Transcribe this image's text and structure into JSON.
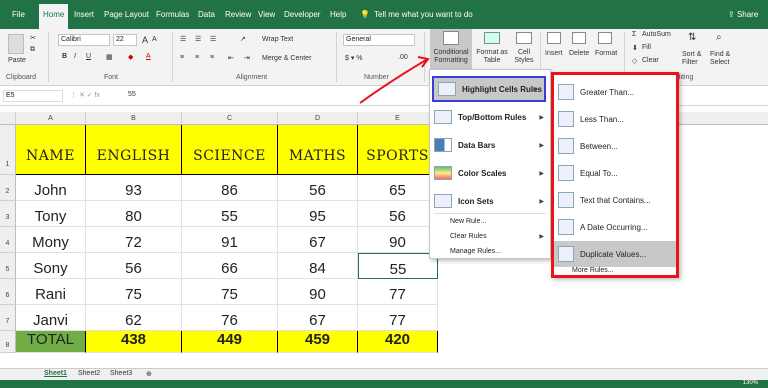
{
  "tabs": [
    "File",
    "Home",
    "Insert",
    "Page Layout",
    "Formulas",
    "Data",
    "Review",
    "View",
    "Developer",
    "Help"
  ],
  "tell_me": "Tell me what you want to do",
  "share": "Share",
  "ribbon": {
    "paste": "Paste",
    "clipboard": "Clipboard",
    "font_name": "Calibri",
    "font_size": "22",
    "font": "Font",
    "wrap_text": "Wrap Text",
    "merge_center": "Merge & Center",
    "alignment": "Alignment",
    "number_format": "General",
    "number": "Number",
    "cond_fmt": "Conditional Formatting",
    "format_table": "Format as Table",
    "cell_styles": "Cell Styles",
    "insert": "Insert",
    "delete": "Delete",
    "format": "Format",
    "autosum": "AutoSum",
    "fill": "Fill",
    "clear": "Clear",
    "editing": "Editing",
    "sort_filter": "Sort & Filter",
    "find_select": "Find & Select",
    "bold": "B",
    "italic": "I",
    "underline": "U",
    "grow": "A",
    "shrink": "A"
  },
  "name_box": "E5",
  "formula_value": "55",
  "columns": [
    "A",
    "B",
    "C",
    "D",
    "E"
  ],
  "headers": [
    "NAME",
    "ENGLISH",
    "SCIENCE",
    "MATHS",
    "SPORTS"
  ],
  "rows": [
    {
      "num": "2",
      "cells": [
        "John",
        "93",
        "86",
        "56",
        "65"
      ]
    },
    {
      "num": "3",
      "cells": [
        "Tony",
        "80",
        "55",
        "95",
        "56"
      ]
    },
    {
      "num": "4",
      "cells": [
        "Mony",
        "72",
        "91",
        "67",
        "90"
      ]
    },
    {
      "num": "5",
      "cells": [
        "Sony",
        "56",
        "66",
        "84",
        "55"
      ]
    },
    {
      "num": "6",
      "cells": [
        "Rani",
        "75",
        "75",
        "90",
        "77"
      ]
    },
    {
      "num": "7",
      "cells": [
        "Janvi",
        "62",
        "76",
        "67",
        "77"
      ]
    }
  ],
  "total": {
    "num": "8",
    "cells": [
      "TOTAL",
      "438",
      "449",
      "459",
      "420"
    ]
  },
  "row_nums": [
    "1"
  ],
  "menu": {
    "items": [
      "Highlight Cells Rules",
      "Top/Bottom Rules",
      "Data Bars",
      "Color Scales",
      "Icon Sets"
    ],
    "small": [
      "New Rule...",
      "Clear Rules",
      "Manage Rules..."
    ]
  },
  "submenu": {
    "items": [
      "Greater Than...",
      "Less Than...",
      "Between...",
      "Equal To...",
      "Text that Contains...",
      "A Date Occurring...",
      "Duplicate Values..."
    ],
    "more": "More Rules..."
  },
  "sheets": [
    "Sheet1",
    "Sheet2",
    "Sheet3"
  ],
  "zoom": "130%",
  "colors": {
    "green": "#217346",
    "yellow": "#ffff00",
    "total_green": "#70ad47",
    "red": "#e8141c",
    "blue": "#3b3bd6"
  }
}
